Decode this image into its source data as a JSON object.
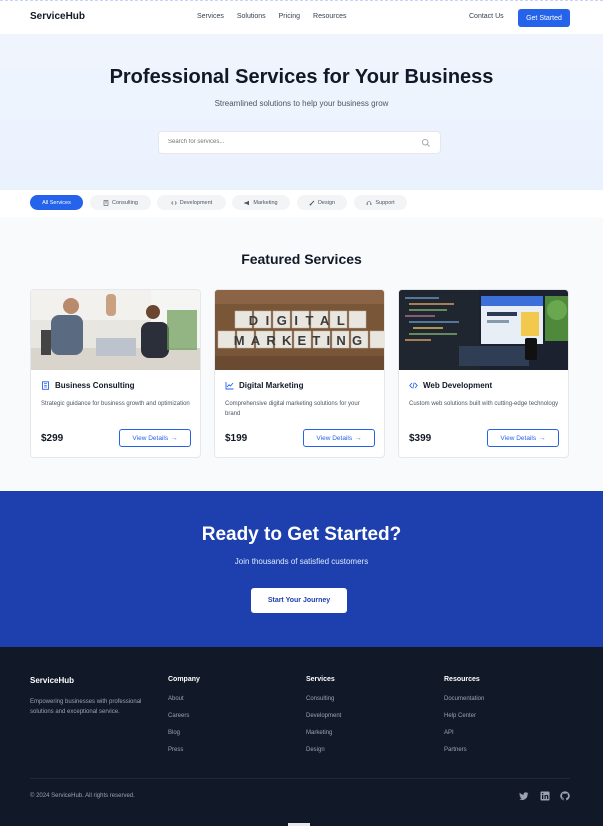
{
  "nav": {
    "brand": "ServiceHub",
    "links": [
      "Services",
      "Solutions",
      "Pricing",
      "Resources"
    ],
    "contact": "Contact Us",
    "get_started": "Get Started"
  },
  "hero": {
    "title": "Professional Services for Your Business",
    "subtitle": "Streamlined solutions to help your business grow",
    "search_placeholder": "Search for services..."
  },
  "categories": [
    {
      "label": "All Services",
      "icon": "none",
      "active": true
    },
    {
      "label": "Consulting",
      "icon": "building-icon"
    },
    {
      "label": "Development",
      "icon": "code-icon"
    },
    {
      "label": "Marketing",
      "icon": "megaphone-icon"
    },
    {
      "label": "Design",
      "icon": "brush-icon"
    },
    {
      "label": "Support",
      "icon": "headset-icon"
    }
  ],
  "featured": {
    "title": "Featured Services",
    "cards": [
      {
        "title": "Business Consulting",
        "icon": "building-icon",
        "description": "Strategic guidance for business growth and optimization",
        "price": "$299",
        "button": "View Details"
      },
      {
        "title": "Digital Marketing",
        "icon": "chart-line-icon",
        "description": "Comprehensive digital marketing solutions for your brand",
        "price": "$199",
        "button": "View Details",
        "image_text": [
          "DIGITAL",
          "MARKETING"
        ]
      },
      {
        "title": "Web Development",
        "icon": "code-icon",
        "description": "Custom web solutions built with cutting-edge technology",
        "price": "$399",
        "button": "View Details"
      }
    ]
  },
  "cta": {
    "title": "Ready to Get Started?",
    "subtitle": "Join thousands of satisfied customers",
    "button": "Start Your Journey"
  },
  "footer": {
    "brand": "ServiceHub",
    "description": "Empowering businesses with professional solutions and exceptional service.",
    "columns": [
      {
        "title": "Company",
        "links": [
          "About",
          "Careers",
          "Blog",
          "Press"
        ]
      },
      {
        "title": "Services",
        "links": [
          "Consulting",
          "Development",
          "Marketing",
          "Design"
        ]
      },
      {
        "title": "Resources",
        "links": [
          "Documentation",
          "Help Center",
          "API",
          "Partners"
        ]
      }
    ],
    "copyright": "© 2024 ServiceHub. All rights reserved.",
    "social": [
      "twitter-icon",
      "linkedin-icon",
      "github-icon"
    ]
  },
  "colors": {
    "primary": "#2563eb",
    "cta_bg": "#1e40af",
    "footer_bg": "#111827"
  }
}
